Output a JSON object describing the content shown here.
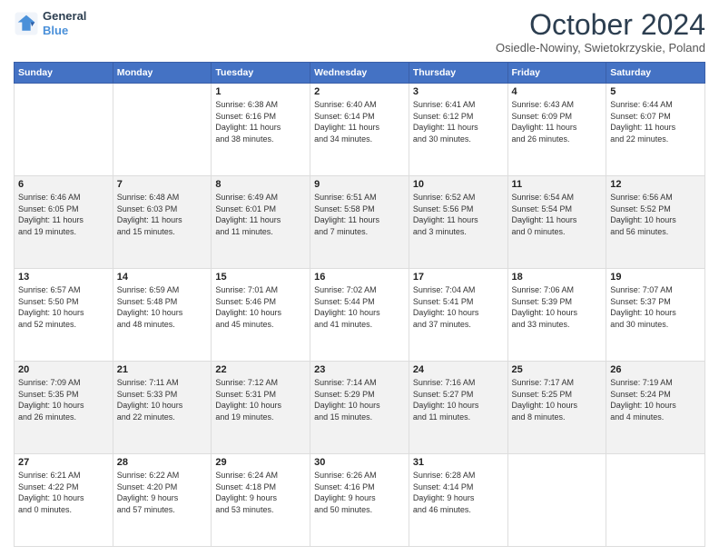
{
  "logo": {
    "line1": "General",
    "line2": "Blue"
  },
  "header": {
    "title": "October 2024",
    "subtitle": "Osiedle-Nowiny, Swietokrzyskie, Poland"
  },
  "weekdays": [
    "Sunday",
    "Monday",
    "Tuesday",
    "Wednesday",
    "Thursday",
    "Friday",
    "Saturday"
  ],
  "weeks": [
    [
      {
        "day": "",
        "info": ""
      },
      {
        "day": "",
        "info": ""
      },
      {
        "day": "1",
        "info": "Sunrise: 6:38 AM\nSunset: 6:16 PM\nDaylight: 11 hours\nand 38 minutes."
      },
      {
        "day": "2",
        "info": "Sunrise: 6:40 AM\nSunset: 6:14 PM\nDaylight: 11 hours\nand 34 minutes."
      },
      {
        "day": "3",
        "info": "Sunrise: 6:41 AM\nSunset: 6:12 PM\nDaylight: 11 hours\nand 30 minutes."
      },
      {
        "day": "4",
        "info": "Sunrise: 6:43 AM\nSunset: 6:09 PM\nDaylight: 11 hours\nand 26 minutes."
      },
      {
        "day": "5",
        "info": "Sunrise: 6:44 AM\nSunset: 6:07 PM\nDaylight: 11 hours\nand 22 minutes."
      }
    ],
    [
      {
        "day": "6",
        "info": "Sunrise: 6:46 AM\nSunset: 6:05 PM\nDaylight: 11 hours\nand 19 minutes."
      },
      {
        "day": "7",
        "info": "Sunrise: 6:48 AM\nSunset: 6:03 PM\nDaylight: 11 hours\nand 15 minutes."
      },
      {
        "day": "8",
        "info": "Sunrise: 6:49 AM\nSunset: 6:01 PM\nDaylight: 11 hours\nand 11 minutes."
      },
      {
        "day": "9",
        "info": "Sunrise: 6:51 AM\nSunset: 5:58 PM\nDaylight: 11 hours\nand 7 minutes."
      },
      {
        "day": "10",
        "info": "Sunrise: 6:52 AM\nSunset: 5:56 PM\nDaylight: 11 hours\nand 3 minutes."
      },
      {
        "day": "11",
        "info": "Sunrise: 6:54 AM\nSunset: 5:54 PM\nDaylight: 11 hours\nand 0 minutes."
      },
      {
        "day": "12",
        "info": "Sunrise: 6:56 AM\nSunset: 5:52 PM\nDaylight: 10 hours\nand 56 minutes."
      }
    ],
    [
      {
        "day": "13",
        "info": "Sunrise: 6:57 AM\nSunset: 5:50 PM\nDaylight: 10 hours\nand 52 minutes."
      },
      {
        "day": "14",
        "info": "Sunrise: 6:59 AM\nSunset: 5:48 PM\nDaylight: 10 hours\nand 48 minutes."
      },
      {
        "day": "15",
        "info": "Sunrise: 7:01 AM\nSunset: 5:46 PM\nDaylight: 10 hours\nand 45 minutes."
      },
      {
        "day": "16",
        "info": "Sunrise: 7:02 AM\nSunset: 5:44 PM\nDaylight: 10 hours\nand 41 minutes."
      },
      {
        "day": "17",
        "info": "Sunrise: 7:04 AM\nSunset: 5:41 PM\nDaylight: 10 hours\nand 37 minutes."
      },
      {
        "day": "18",
        "info": "Sunrise: 7:06 AM\nSunset: 5:39 PM\nDaylight: 10 hours\nand 33 minutes."
      },
      {
        "day": "19",
        "info": "Sunrise: 7:07 AM\nSunset: 5:37 PM\nDaylight: 10 hours\nand 30 minutes."
      }
    ],
    [
      {
        "day": "20",
        "info": "Sunrise: 7:09 AM\nSunset: 5:35 PM\nDaylight: 10 hours\nand 26 minutes."
      },
      {
        "day": "21",
        "info": "Sunrise: 7:11 AM\nSunset: 5:33 PM\nDaylight: 10 hours\nand 22 minutes."
      },
      {
        "day": "22",
        "info": "Sunrise: 7:12 AM\nSunset: 5:31 PM\nDaylight: 10 hours\nand 19 minutes."
      },
      {
        "day": "23",
        "info": "Sunrise: 7:14 AM\nSunset: 5:29 PM\nDaylight: 10 hours\nand 15 minutes."
      },
      {
        "day": "24",
        "info": "Sunrise: 7:16 AM\nSunset: 5:27 PM\nDaylight: 10 hours\nand 11 minutes."
      },
      {
        "day": "25",
        "info": "Sunrise: 7:17 AM\nSunset: 5:25 PM\nDaylight: 10 hours\nand 8 minutes."
      },
      {
        "day": "26",
        "info": "Sunrise: 7:19 AM\nSunset: 5:24 PM\nDaylight: 10 hours\nand 4 minutes."
      }
    ],
    [
      {
        "day": "27",
        "info": "Sunrise: 6:21 AM\nSunset: 4:22 PM\nDaylight: 10 hours\nand 0 minutes."
      },
      {
        "day": "28",
        "info": "Sunrise: 6:22 AM\nSunset: 4:20 PM\nDaylight: 9 hours\nand 57 minutes."
      },
      {
        "day": "29",
        "info": "Sunrise: 6:24 AM\nSunset: 4:18 PM\nDaylight: 9 hours\nand 53 minutes."
      },
      {
        "day": "30",
        "info": "Sunrise: 6:26 AM\nSunset: 4:16 PM\nDaylight: 9 hours\nand 50 minutes."
      },
      {
        "day": "31",
        "info": "Sunrise: 6:28 AM\nSunset: 4:14 PM\nDaylight: 9 hours\nand 46 minutes."
      },
      {
        "day": "",
        "info": ""
      },
      {
        "day": "",
        "info": ""
      }
    ]
  ]
}
